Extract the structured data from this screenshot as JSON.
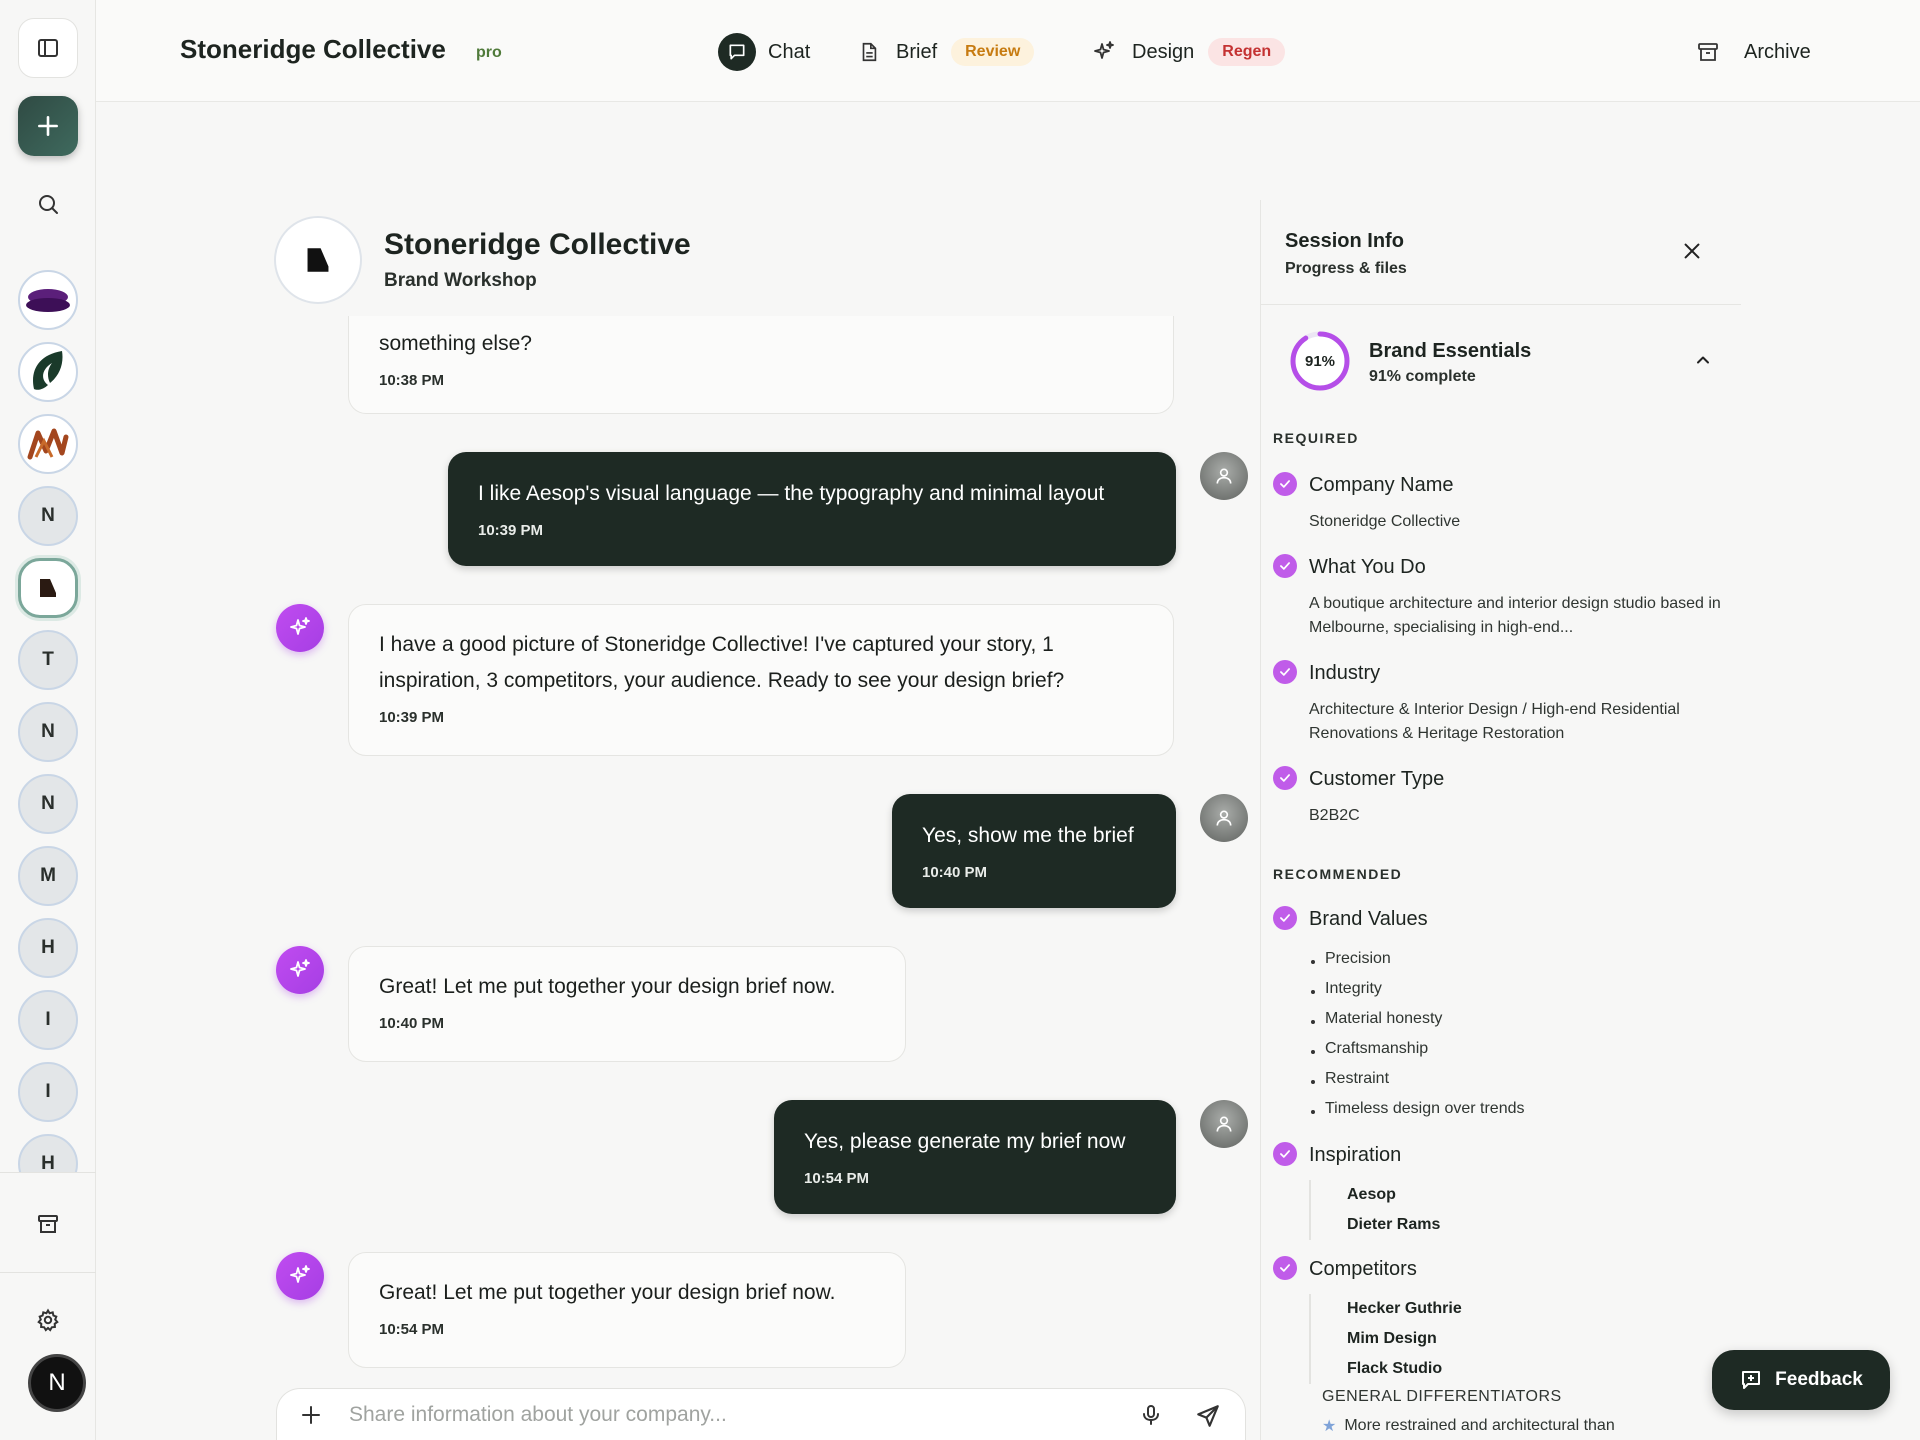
{
  "app": {
    "brand": "Stoneridge Collective",
    "plan_badge": "pro"
  },
  "nav": {
    "chat": "Chat",
    "brief": "Brief",
    "brief_badge": "Review",
    "design": "Design",
    "design_badge": "Regen",
    "archive": "Archive"
  },
  "sidebar": {
    "initials": [
      "N",
      "T",
      "N",
      "N",
      "M",
      "H",
      "I",
      "I",
      "H"
    ],
    "user_initial": "N"
  },
  "conversation": {
    "title": "Stoneridge Collective",
    "subtitle": "Brand Workshop"
  },
  "messages": [
    {
      "role": "assistant",
      "text": "something else?",
      "time": "10:38 PM"
    },
    {
      "role": "user",
      "text": "I like Aesop's visual language — the typography and minimal layout",
      "time": "10:39 PM"
    },
    {
      "role": "assistant",
      "text": "I have a good picture of Stoneridge Collective! I've captured your story, 1 inspiration, 3 competitors, your audience. Ready to see your design brief?",
      "time": "10:39 PM"
    },
    {
      "role": "user",
      "text": "Yes, show me the brief",
      "time": "10:40 PM"
    },
    {
      "role": "assistant",
      "text": "Great! Let me put together your design brief now.",
      "time": "10:40 PM"
    },
    {
      "role": "user",
      "text": "Yes, please generate my brief now",
      "time": "10:54 PM"
    },
    {
      "role": "assistant",
      "text": "Great! Let me put together your design brief now.",
      "time": "10:54 PM"
    }
  ],
  "composer": {
    "placeholder": "Share information about your company..."
  },
  "session": {
    "title": "Session Info",
    "subtitle": "Progress & files",
    "essentials_title": "Brand Essentials",
    "essentials_progress": 91,
    "progress_label": "91%",
    "essentials_sub": "91% complete",
    "required_label": "REQUIRED",
    "recommended_label": "RECOMMENDED",
    "required": [
      {
        "title": "Company Name",
        "value": "Stoneridge Collective"
      },
      {
        "title": "What You Do",
        "value": "A boutique architecture and interior design studio based in Melbourne, specialising in high-end..."
      },
      {
        "title": "Industry",
        "value": "Architecture & Interior Design / High-end Residential Renovations & Heritage Restoration"
      },
      {
        "title": "Customer Type",
        "value": "B2B2C"
      }
    ],
    "brand_values_title": "Brand Values",
    "brand_values": [
      "Precision",
      "Integrity",
      "Material honesty",
      "Craftsmanship",
      "Restraint",
      "Timeless design over trends"
    ],
    "inspiration_title": "Inspiration",
    "inspiration": [
      "Aesop",
      "Dieter Rams"
    ],
    "competitors_title": "Competitors",
    "competitors": [
      "Hecker Guthrie",
      "Mim Design",
      "Flack Studio"
    ],
    "general_diff_label": "GENERAL DIFFERENTIATORS",
    "general_diff_item": "More restrained and architectural than"
  },
  "feedback": {
    "label": "Feedback"
  },
  "colors": {
    "accent": "#1e2a24",
    "check": "#c05ce9",
    "review": "#c77b10",
    "regen": "#c43232"
  }
}
